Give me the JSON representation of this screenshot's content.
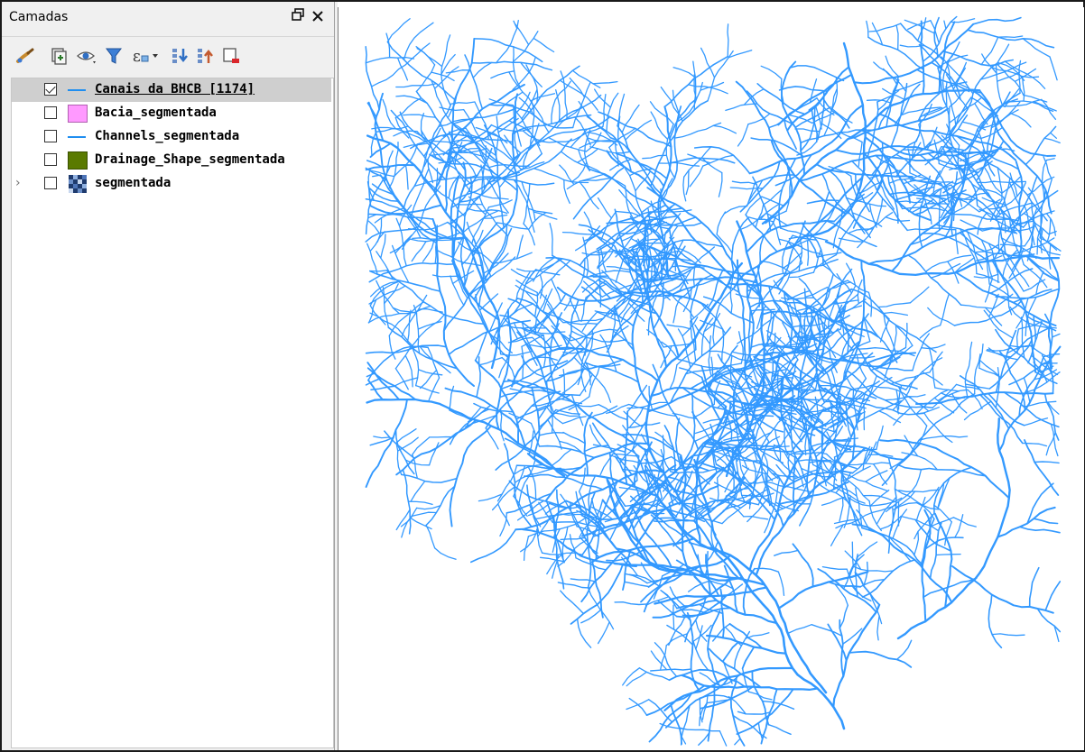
{
  "panel": {
    "title": "Camadas",
    "float_label": "🗗",
    "close_label": "✕"
  },
  "toolbar": {
    "items": [
      {
        "name": "style-manager-icon"
      },
      {
        "name": "add-group-icon"
      },
      {
        "name": "manage-visibility-icon"
      },
      {
        "name": "filter-legend-icon"
      },
      {
        "name": "filter-expression-icon"
      },
      {
        "name": "expand-all-icon"
      },
      {
        "name": "collapse-all-icon"
      },
      {
        "name": "remove-layer-icon"
      }
    ]
  },
  "layers": [
    {
      "label": "Canais da BHCB [1174]",
      "checked": true,
      "symbol": "line",
      "color": "#1f8ef0",
      "selected": true
    },
    {
      "label": "Bacia_segmentada",
      "checked": false,
      "symbol": "fill",
      "color": "#ff99ff",
      "selected": false
    },
    {
      "label": "Channels_segmentada",
      "checked": false,
      "symbol": "line",
      "color": "#1f8ef0",
      "selected": false
    },
    {
      "label": "Drainage_Shape_segmentada",
      "checked": false,
      "symbol": "fill",
      "color": "#5a7a00",
      "selected": false
    },
    {
      "label": "segmentada",
      "checked": false,
      "symbol": "raster",
      "color": "#2a4d8a",
      "selected": false,
      "expandable": true
    }
  ],
  "map": {
    "stream_color": "#3399ff",
    "background": "#ffffff"
  }
}
